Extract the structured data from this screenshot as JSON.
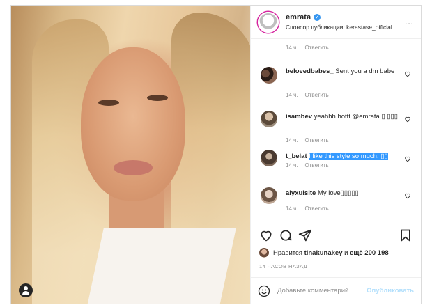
{
  "post": {
    "author": "emrata",
    "sponsor_line": "Спонсор публикации: kerastase_official",
    "more": "..."
  },
  "comments": [
    {
      "time": "14 ч.",
      "reply": "Ответить"
    },
    {
      "user": "belovedbabes_",
      "text": "Sent you a dm babe",
      "time": "14 ч.",
      "reply": "Ответить"
    },
    {
      "user": "isambev",
      "text": "yeahhh hottt @emrata ▯ ▯▯▯",
      "time": "14 ч.",
      "reply": "Ответить"
    },
    {
      "user": "t_belat",
      "text": "I like this style so much. ▯▯",
      "time": "14 ч.",
      "reply": "Ответить"
    },
    {
      "user": "aiyxuisite",
      "text": "My love▯▯▯▯▯",
      "time": "14 ч.",
      "reply": "Ответить"
    }
  ],
  "likes": {
    "prefix": "Нравится",
    "user": "tinakunakey",
    "suffix": "и",
    "count": "ещё 200 198"
  },
  "time_ago": "14 ЧАСОВ НАЗАД",
  "composer": {
    "placeholder": "Добавьте комментарий...",
    "publish": "Опубликовать"
  },
  "icons": [
    "user-tag-icon",
    "heart-icon",
    "comment-icon",
    "share-icon",
    "bookmark-icon",
    "smile-icon",
    "verified-icon"
  ],
  "colors": {
    "accent": "#3897f0",
    "selection": "#3399ff",
    "muted": "#8e8e8e",
    "publish_disabled": "#b2dffc"
  }
}
